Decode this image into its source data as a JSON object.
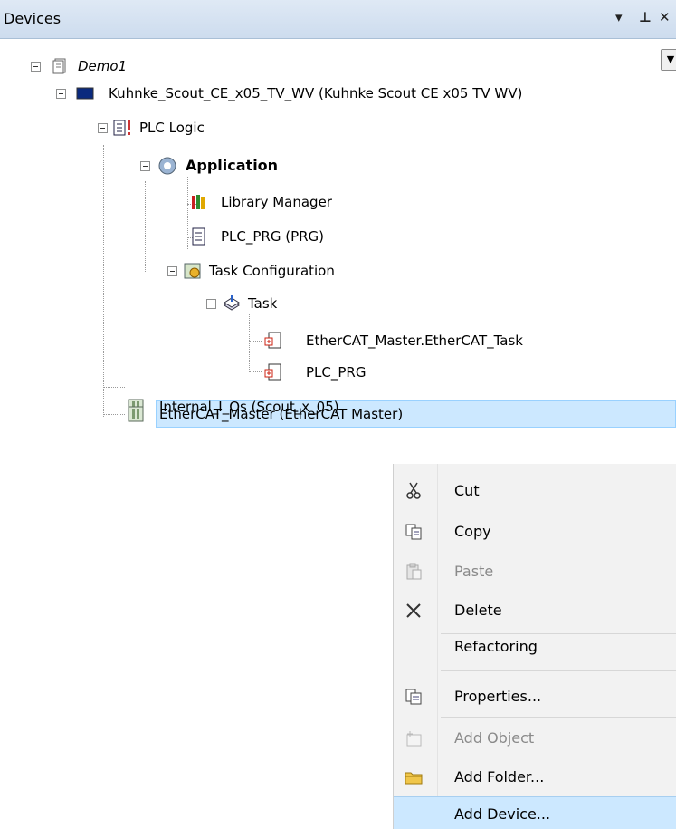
{
  "panel": {
    "title": "Devices",
    "pin": "ᵖ",
    "close": "✕",
    "dropdown": "▾"
  },
  "tree": {
    "items": [
      {
        "label": "Demo1"
      },
      {
        "label": "Kuhnke_Scout_CE_x05_TV_WV (Kuhnke Scout CE x05 TV WV)"
      },
      {
        "label": "PLC Logic"
      },
      {
        "label": "Application"
      },
      {
        "label": "Library Manager"
      },
      {
        "label": "PLC_PRG (PRG)"
      },
      {
        "label": "Task Configuration"
      },
      {
        "label": "Task"
      },
      {
        "label": "EtherCAT_Master.EtherCAT_Task"
      },
      {
        "label": "PLC_PRG"
      },
      {
        "label": "Internal_I_Os (Scout_x_05)"
      },
      {
        "label": "EtherCAT_Master (EtherCAT Master)"
      }
    ]
  },
  "context_menu": {
    "items": [
      {
        "label": "Cut",
        "icon": "scissors-icon"
      },
      {
        "label": "Copy",
        "icon": "copy-icon"
      },
      {
        "label": "Paste",
        "icon": "paste-icon",
        "disabled": true
      },
      {
        "label": "Delete",
        "icon": "delete-x-icon"
      },
      {
        "label": "Refactoring"
      },
      {
        "label": "Properties...",
        "icon": "properties-icon"
      },
      {
        "label": "Add Object",
        "icon": "add-object-icon",
        "disabled": true
      },
      {
        "label": "Add Folder...",
        "icon": "folder-icon"
      },
      {
        "label": "Add Device...",
        "highlighted": true
      }
    ]
  }
}
